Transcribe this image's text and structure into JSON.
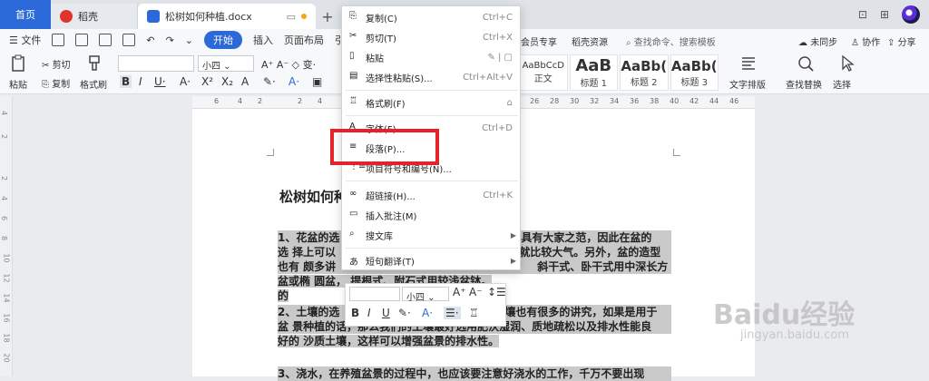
{
  "tabs": {
    "home": "首页",
    "daoke": "稻壳",
    "doc": "松树如何种植.docx"
  },
  "menu": {
    "file": "文件",
    "start": "开始",
    "insert": "插入",
    "page_layout": "页面布局",
    "reference": "引用",
    "member": "会员专享",
    "daoke_res": "稻壳资源",
    "search_placeholder": "查找命令、搜索模板",
    "unsync": "未同步",
    "collab": "协作",
    "share": "分享"
  },
  "ribbon": {
    "paste": "粘贴",
    "cut": "剪切",
    "copy": "复制",
    "format_brush": "格式刷",
    "font_size": "小四",
    "styles": [
      {
        "sample": "AaBbCcD",
        "label": "正文"
      },
      {
        "sample": "AaB",
        "label": "标题 1"
      },
      {
        "sample": "AaBb(",
        "label": "标题 2"
      },
      {
        "sample": "AaBb(",
        "label": "标题 3"
      }
    ],
    "text_layout": "文字排版",
    "find_replace": "查找替换",
    "select": "选择"
  },
  "ruler": [
    "6",
    "4",
    "2",
    "2",
    "4",
    "26",
    "28",
    "30",
    "32",
    "34",
    "36",
    "38",
    "40",
    "42",
    "44",
    "46"
  ],
  "vruler": [
    "4",
    "2",
    "2",
    "4",
    "6",
    "8",
    "10",
    "12",
    "14",
    "16",
    "18",
    "20",
    "22"
  ],
  "document": {
    "title": "松树如何种",
    "p1_line1_left": "1、花盆的选",
    "p1_line1_right": "具有大家之范，因此在盆的",
    "p1_line2_left": "选 择上可以",
    "p1_line2_right": "就比较大气。另外，盆的造型",
    "p1_line3_left": "也有 颇多讲",
    "p1_line3_right": "斜干式、卧干式用中深长方",
    "p1_line4": "盆或椭 圆盆，   提根式、附石式用较浅盆钵。",
    "p1_line5": "的",
    "p2_line1_left": "2、土壤的选",
    "p2_line1_right": "壤也有很多的讲究，如果是用于",
    "p2_line2": "盆 景种植的话，那么我们的土壤最好选用肥沃湿润、质地疏松以及排水性能良",
    "p2_line3": "好的 沙质土壤，这样可以增强盆景的排水性。",
    "p3_line1": "3、浇水，在养殖盆景的过程中，也应该要注意好浇水的工作，千万不要出现"
  },
  "minibar": {
    "font_size": "小四"
  },
  "context_menu": {
    "items": [
      {
        "label": "复制(C)",
        "shortcut": "Ctrl+C"
      },
      {
        "label": "剪切(T)",
        "shortcut": "Ctrl+X"
      },
      {
        "label": "粘贴",
        "shortcut": ""
      },
      {
        "label": "选择性粘贴(S)...",
        "shortcut": "Ctrl+Alt+V"
      },
      {
        "label": "格式刷(F)",
        "shortcut": ""
      },
      {
        "label": "字体(F)...",
        "shortcut": "Ctrl+D"
      },
      {
        "label": "段落(P)...",
        "shortcut": ""
      },
      {
        "label": "项目符号和编号(N)...",
        "shortcut": ""
      },
      {
        "label": "超链接(H)...",
        "shortcut": "Ctrl+K"
      },
      {
        "label": "插入批注(M)",
        "shortcut": ""
      },
      {
        "label": "搜文库",
        "shortcut": ""
      },
      {
        "label": "短句翻译(T)",
        "shortcut": ""
      }
    ]
  },
  "watermark": {
    "brand": "Baidu经验",
    "url": "jingyan.baidu.com"
  },
  "colors": {
    "accent": "#2c69d8",
    "highlight_box": "#e2232a",
    "selection": "#c9c9c9"
  }
}
